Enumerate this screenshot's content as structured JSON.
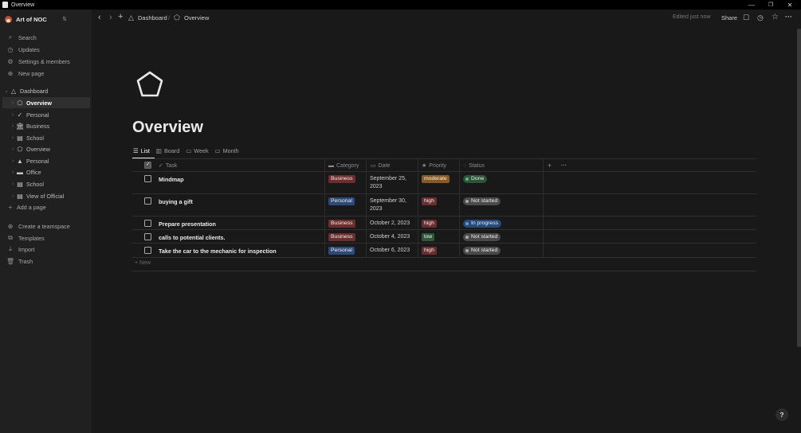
{
  "window": {
    "title": "Overview",
    "minimize": "—",
    "restore": "❐",
    "close": "✕"
  },
  "workspace": {
    "name": "Art of NOC",
    "caret": "⇅"
  },
  "sidebar": {
    "top_items": [
      {
        "icon": "⌕",
        "label": "Search"
      },
      {
        "icon": "◷",
        "label": "Updates"
      },
      {
        "icon": "⚙",
        "label": "Settings & members"
      },
      {
        "icon": "⊕",
        "label": "New page"
      }
    ],
    "dashboard": {
      "icon": "△",
      "label": "Dashboard"
    },
    "children": [
      {
        "icon": "⬠",
        "label": "Overview"
      },
      {
        "icon": "✓",
        "label": "Personal"
      },
      {
        "icon": "🏛",
        "label": "Business"
      },
      {
        "icon": "▤",
        "label": "School"
      },
      {
        "icon": "⬠",
        "label": "Overview"
      },
      {
        "icon": "▲",
        "label": "Personal"
      },
      {
        "icon": "▬",
        "label": "Office"
      },
      {
        "icon": "▤",
        "label": "School"
      },
      {
        "icon": "▤",
        "label": "View of Official"
      }
    ],
    "add_page": {
      "icon": "+",
      "label": "Add a page"
    },
    "bottom_items": [
      {
        "icon": "⊕",
        "label": "Create a teamspace"
      },
      {
        "icon": "⧉",
        "label": "Templates"
      },
      {
        "icon": "⤓",
        "label": "Import"
      },
      {
        "icon": "🗑",
        "label": "Trash"
      }
    ]
  },
  "topbar": {
    "back": "‹",
    "forward": "›",
    "add": "+",
    "breadcrumb": [
      "Dashboard",
      "Overview"
    ],
    "separator": "/",
    "edited": "Edited just now",
    "share": "Share",
    "comment_icon": "☐",
    "history_icon": "◷",
    "favorite_icon": "☆",
    "more_icon": "···"
  },
  "page": {
    "title": "Overview"
  },
  "views": [
    {
      "icon": "☰",
      "label": "List"
    },
    {
      "icon": "▥",
      "label": "Board"
    },
    {
      "icon": "▭",
      "label": "Week"
    },
    {
      "icon": "▭",
      "label": "Month"
    }
  ],
  "table": {
    "headers": {
      "task": "Task",
      "category": "Category",
      "date": "Date",
      "priority": "Priority",
      "status": "Status",
      "add": "+",
      "more": "···"
    },
    "rows": [
      {
        "task": "Mindmap",
        "category": "Business",
        "date_line1": "September 25,",
        "date_line2": "2023",
        "priority": "moderate",
        "status": "Done"
      },
      {
        "task": "buying a gift",
        "category": "Personal",
        "date_line1": "September 30,",
        "date_line2": "2023",
        "priority": "high",
        "status": "Not started"
      },
      {
        "task": "Prepare presentation",
        "category": "Business",
        "date_line1": "October 2, 2023",
        "date_line2": "",
        "priority": "high",
        "status": "In progress"
      },
      {
        "task": "calls to potential clients.",
        "category": "Business",
        "date_line1": "October 4, 2023",
        "date_line2": "",
        "priority": "low",
        "status": "Not started"
      },
      {
        "task": "Take the car to the mechanic for inspection",
        "category": "Personal",
        "date_line1": "October 6, 2023",
        "date_line2": "",
        "priority": "high",
        "status": "Not started"
      }
    ],
    "new_row": "+ New"
  },
  "colors": {
    "business": "#6e2d2d",
    "personal": "#2c4a75",
    "moderate": "#8a5a1f",
    "high": "#6e2d2d",
    "low": "#2f5a3a",
    "done_bg": "#2b5438",
    "done_dot": "#4fc07a",
    "not_started_bg": "#4a4a4a",
    "not_started_dot": "#a8a8a8",
    "in_progress_bg": "#274a78",
    "in_progress_dot": "#5a9ae8"
  },
  "help": "?"
}
